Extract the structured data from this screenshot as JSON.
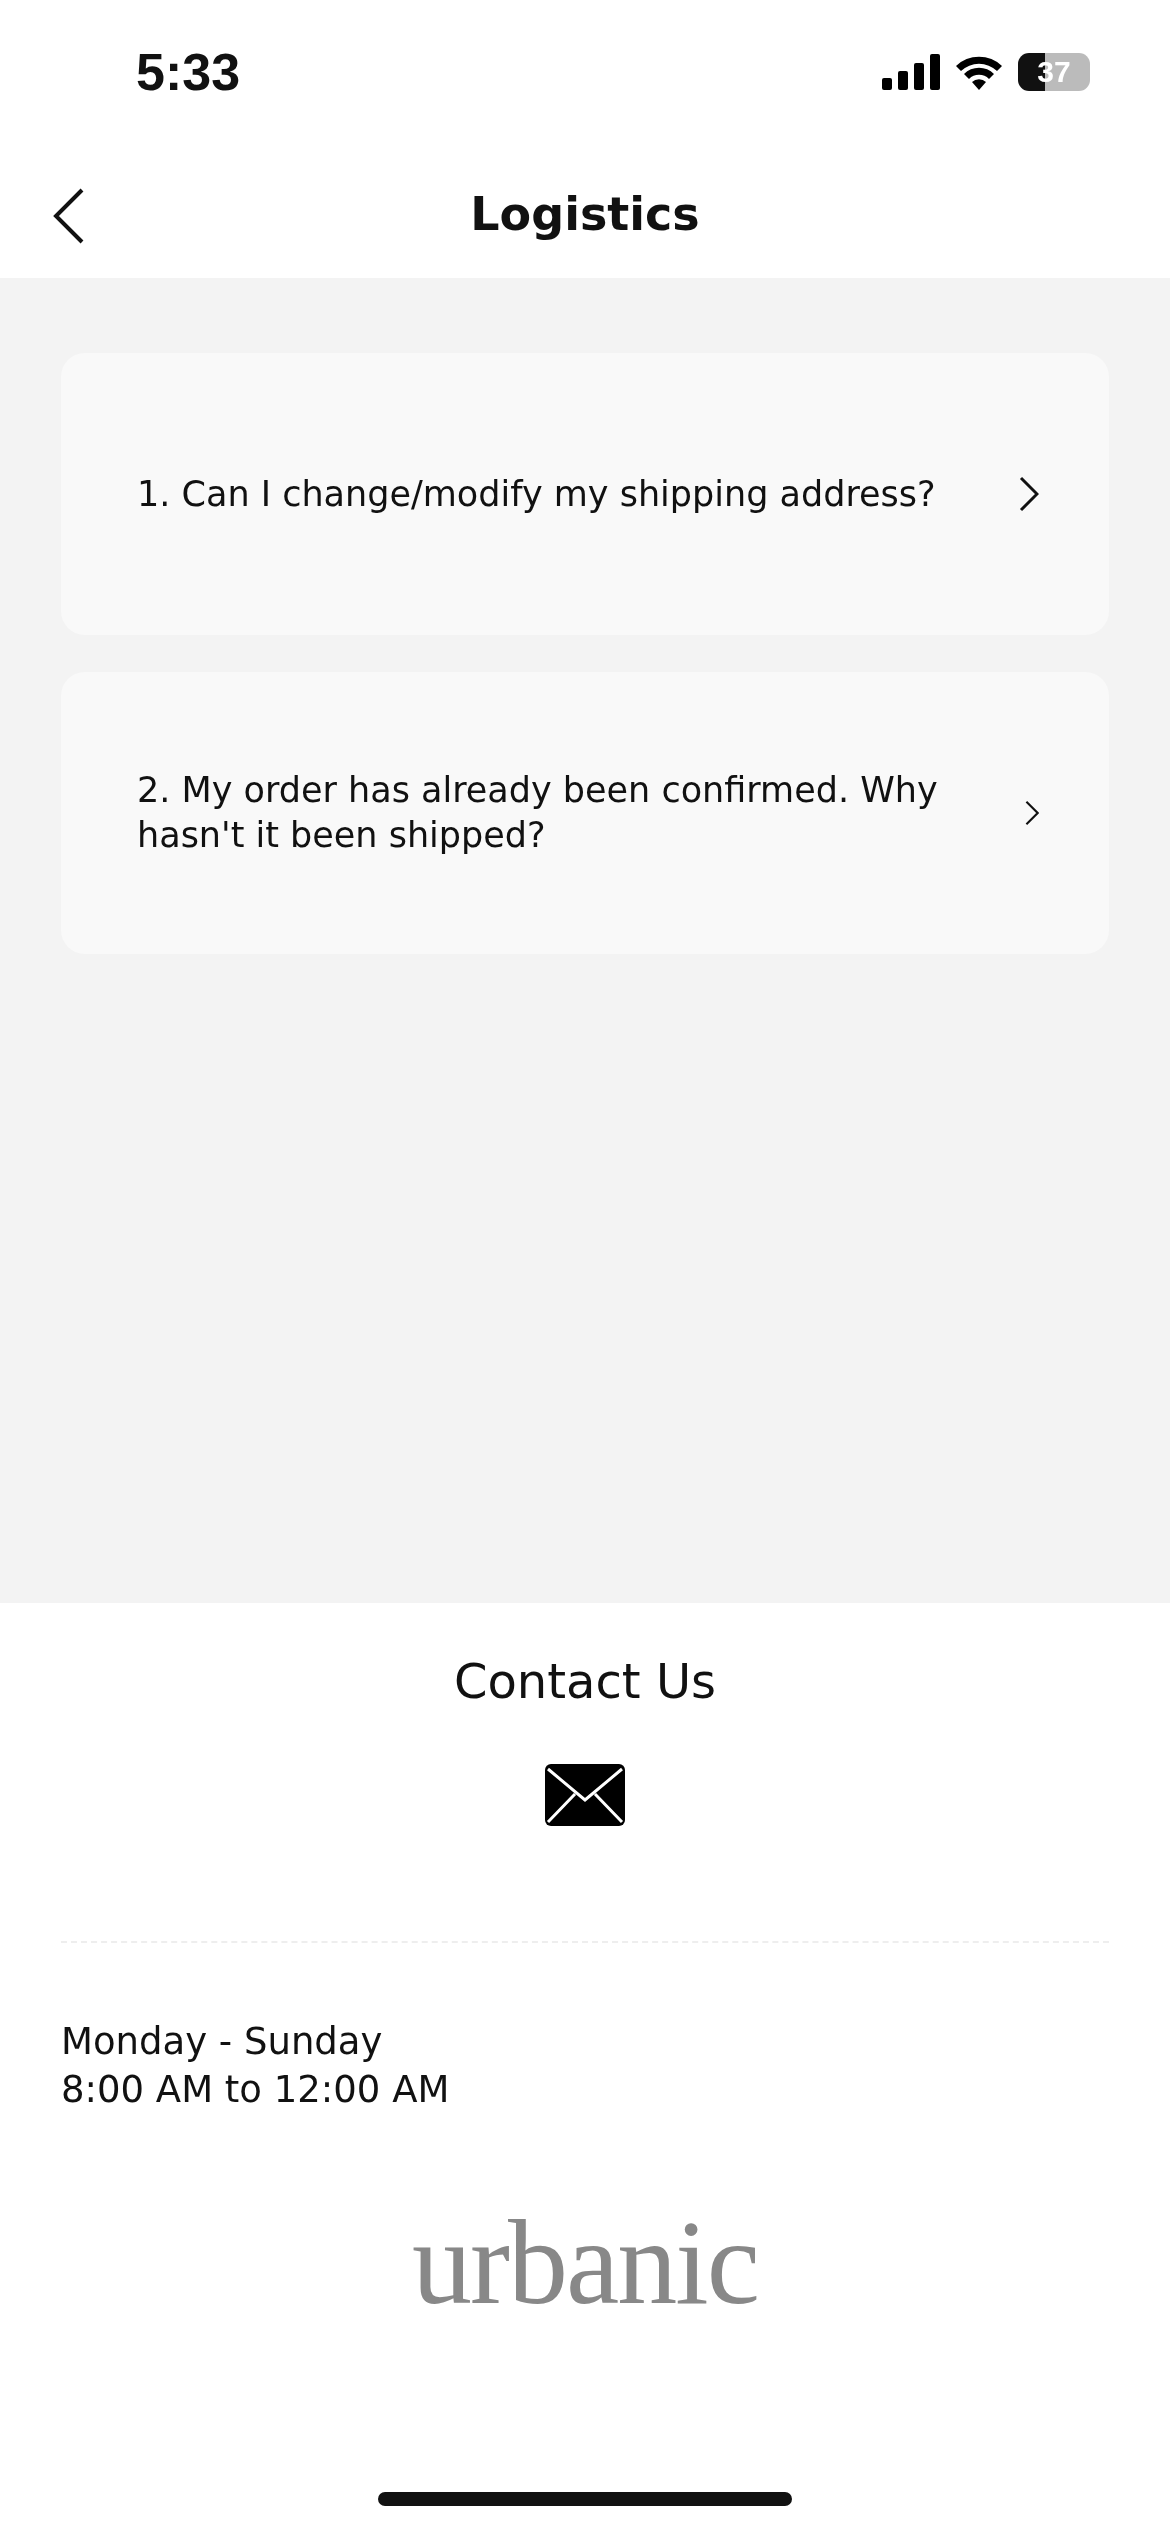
{
  "status_bar": {
    "time": "5:33",
    "battery": "37"
  },
  "header": {
    "title": "Logistics"
  },
  "faq": [
    {
      "question": "1. Can I change/modify my shipping address?"
    },
    {
      "question": "2. My order has already been confirmed. Why hasn't it been shipped?"
    }
  ],
  "contact": {
    "title": "Contact Us",
    "hours": [
      "Monday - Sunday",
      "8:00 AM to 12:00 AM"
    ]
  },
  "logo": "urbanic"
}
